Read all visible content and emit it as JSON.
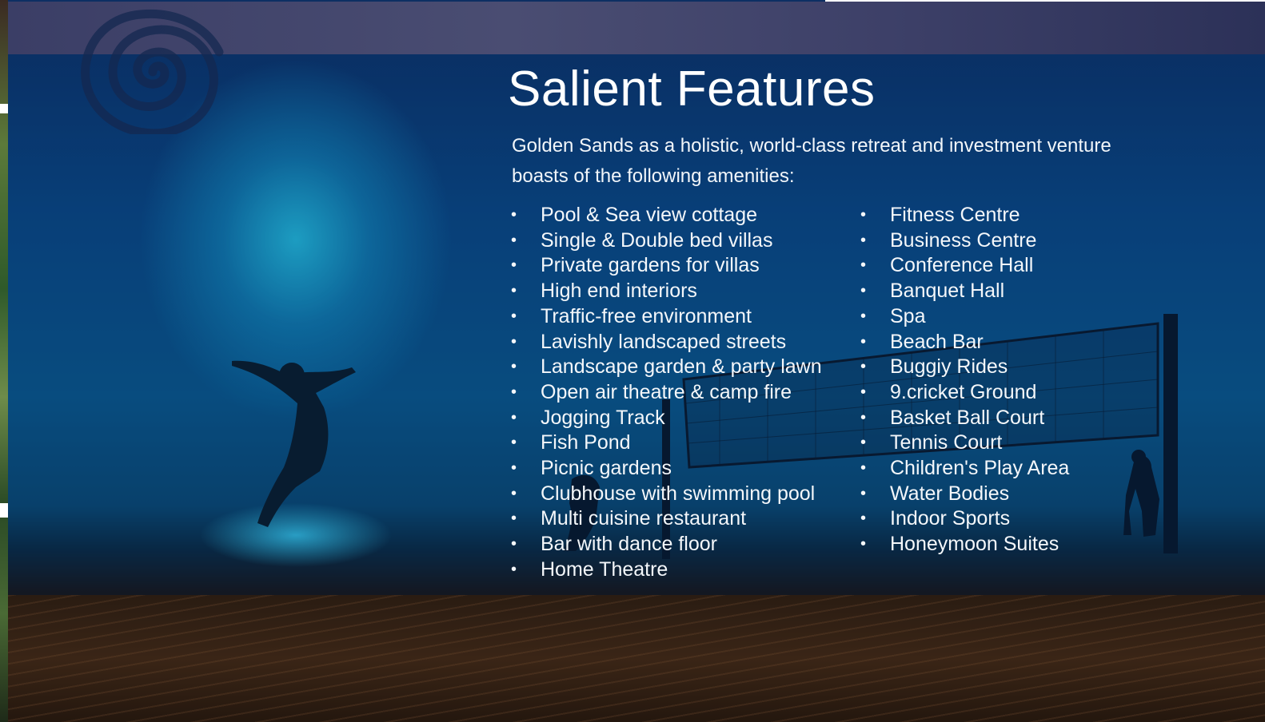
{
  "slide": {
    "title": "Salient Features",
    "intro": "Golden Sands as a holistic, world-class retreat and investment venture boasts of the following amenities:",
    "bullet_glyph": "•",
    "logo_icon": "spiral-logo-icon",
    "colors": {
      "panel": "#0B3C78",
      "text": "#FFFFFF",
      "glow": "#28D2F0"
    }
  },
  "features": {
    "column1": [
      "Pool & Sea view cottage",
      "Single & Double bed villas",
      "Private gardens for villas",
      "High end interiors",
      "Traffic-free environment",
      "Lavishly landscaped streets",
      "Landscape garden & party lawn",
      "Open air theatre & camp fire",
      "Jogging Track",
      "Fish Pond",
      "Picnic gardens",
      "Clubhouse with swimming pool",
      "Multi cuisine restaurant",
      "Bar with dance floor",
      "Home Theatre"
    ],
    "column2": [
      "Fitness Centre",
      "Business Centre",
      "Conference Hall",
      "Banquet Hall",
      "Spa",
      "Beach Bar",
      "Buggiy Rides",
      "9.cricket Ground",
      "Basket Ball Court",
      "Tennis Court",
      "Children's Play Area",
      "Water Bodies",
      "Indoor Sports",
      "Honeymoon Suites"
    ]
  }
}
